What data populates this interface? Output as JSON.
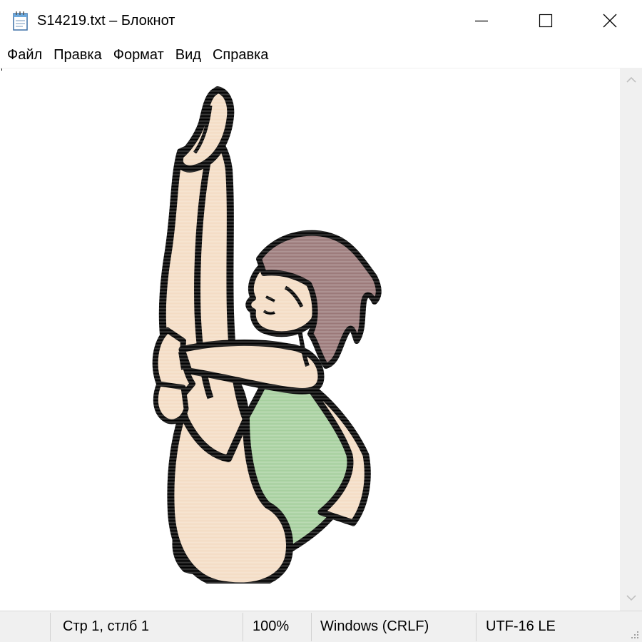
{
  "window": {
    "title": "S14219.txt – Блокнот",
    "app_icon": "notepad-icon",
    "controls": {
      "minimize_icon": "minimize-icon",
      "maximize_icon": "maximize-icon",
      "close_icon": "close-icon"
    }
  },
  "menu": {
    "items": [
      {
        "label": "Файл"
      },
      {
        "label": "Правка"
      },
      {
        "label": "Формат"
      },
      {
        "label": "Вид"
      },
      {
        "label": "Справка"
      }
    ]
  },
  "editor": {
    "content_icon": "diver-pike-position-illustration",
    "colors": {
      "skin": "#f4dcc4",
      "hair": "#9a7878",
      "swimsuit": "#a6cf9e",
      "outline": "#000000"
    }
  },
  "scrollbar": {
    "up_icon": "chevron-up-icon",
    "down_icon": "chevron-down-icon"
  },
  "status": {
    "position": "Стр 1, стлб 1",
    "zoom": "100%",
    "line_endings": "Windows (CRLF)",
    "encoding": "UTF-16 LE",
    "grip_icon": "resize-grip-icon"
  }
}
